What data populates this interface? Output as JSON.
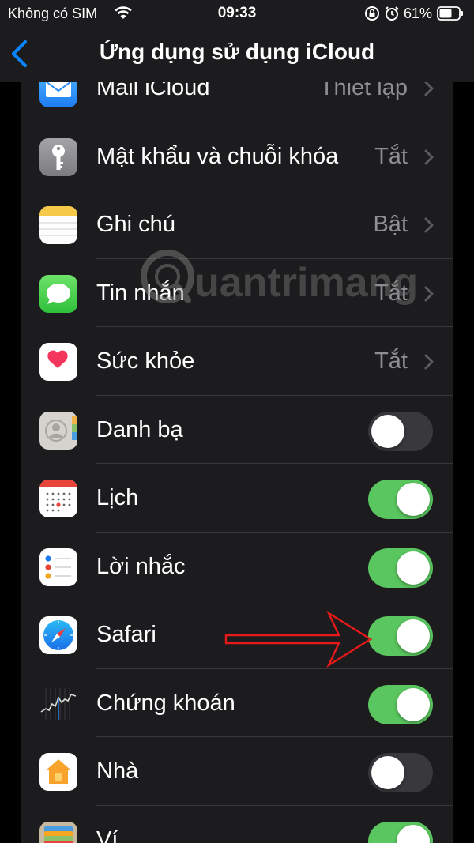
{
  "status": {
    "carrier": "Không có SIM",
    "time": "09:33",
    "battery": "61%"
  },
  "nav": {
    "title": "Ứng dụng sử dụng iCloud"
  },
  "rows": [
    {
      "label": "Mail iCloud",
      "value": "Thiết lập",
      "icon": "mail-icon"
    },
    {
      "label": "Mật khẩu và chuỗi khóa",
      "value": "Tắt",
      "icon": "key-icon"
    },
    {
      "label": "Ghi chú",
      "value": "Bật",
      "icon": "notes-icon"
    },
    {
      "label": "Tin nhắn",
      "value": "Tắt",
      "icon": "messages-icon"
    },
    {
      "label": "Sức khỏe",
      "value": "Tắt",
      "icon": "health-icon"
    },
    {
      "label": "Danh bạ",
      "toggle": false,
      "icon": "contacts-icon"
    },
    {
      "label": "Lịch",
      "toggle": true,
      "icon": "calendar-icon"
    },
    {
      "label": "Lời nhắc",
      "toggle": true,
      "icon": "reminders-icon"
    },
    {
      "label": "Safari",
      "toggle": true,
      "icon": "safari-icon"
    },
    {
      "label": "Chứng khoán",
      "toggle": true,
      "icon": "stocks-icon"
    },
    {
      "label": "Nhà",
      "toggle": false,
      "icon": "home-icon"
    },
    {
      "label": "Ví",
      "toggle": true,
      "icon": "wallet-icon"
    }
  ],
  "watermark": {
    "text": "uantrimang"
  },
  "colors": {
    "accent": "#0a84ff",
    "toggle_on": "#5ac65f",
    "toggle_off": "#39393d",
    "annotation": "#e8191a"
  }
}
